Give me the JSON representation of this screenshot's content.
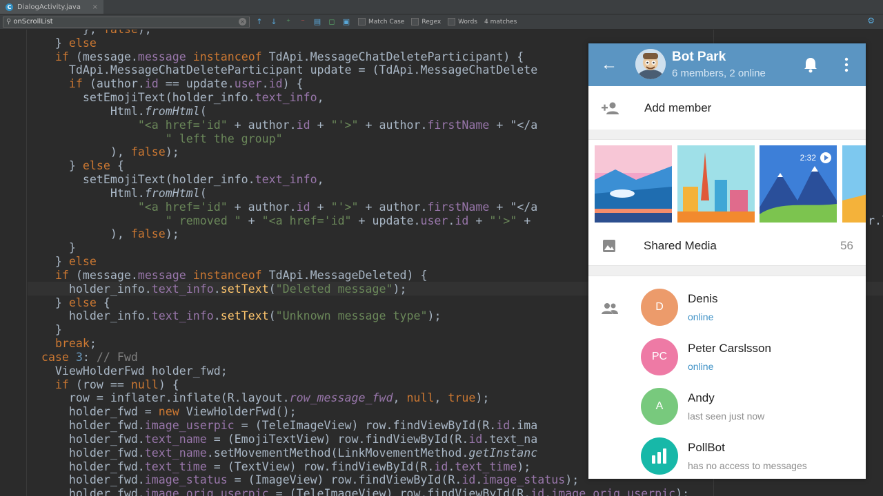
{
  "tab": {
    "title": "DialogActivity.java",
    "close": "×"
  },
  "find": {
    "query": "onScrollList",
    "options": [
      "Match Case",
      "Regex",
      "Words"
    ],
    "matches": "4 matches"
  },
  "code_lines": [
    "            }, false);",
    "        } else",
    "        if (message.message instanceof TdApi.MessageChatDeleteParticipant) {",
    "          TdApi.MessageChatDeleteParticipant update = (TdApi.MessageChatDelete",
    "          if (author.id == update.user.id) {",
    "            setEmojiText(holder_info.text_info,",
    "                Html.fromHtml(",
    "                    \"<a href='id\" + author.id + \"'>\" + author.firstName + \"</a",
    "                        \" left the group\"",
    "                ), false);",
    "          } else {",
    "            setEmojiText(holder_info.text_info,",
    "                Html.fromHtml(",
    "                    \"<a href='id\" + author.id + \"'>\" + author.firstName + \"</a",
    "                        \" removed \" + \"<a href='id\" + update.user.id + \"'>\" +",
    "                ), false);",
    "          }",
    "        } else",
    "        if (message.message instanceof TdApi.MessageDeleted) {",
    "          holder_info.text_info.setText(\"Deleted message\");",
    "        } else {",
    "          holder_info.text_info.setText(\"Unknown message type\");",
    "        }",
    "        break;",
    "      case 3: // Fwd",
    "        ViewHolderFwd holder_fwd;",
    "        if (row == null) {",
    "          row = inflater.inflate(R.layout.row_message_fwd, null, true);",
    "          holder_fwd = new ViewHolderFwd();",
    "          holder_fwd.image_userpic = (TeleImageView) row.findViewById(R.id.ima",
    "          holder_fwd.text_name = (EmojiTextView) row.findViewById(R.id.text_na",
    "          holder_fwd.text_name.setMovementMethod(LinkMovementMethod.getInstanc",
    "          holder_fwd.text_time = (TextView) row.findViewById(R.id.text_time);",
    "          holder_fwd.image_status = (ImageView) row.findViewById(R.id.image_status);",
    "          holder_fwd.image_orig_userpic = (TeleImageView) row.findViewById(R.id.image_orig_userpic);"
  ],
  "code_tail": "r.l",
  "chat": {
    "title": "Bot Park",
    "subtitle": "6 members, 2 online",
    "add_member": "Add member",
    "shared_media": {
      "label": "Shared Media",
      "count": "56"
    },
    "video_duration": "2:32",
    "members": [
      {
        "initials": "D",
        "name": "Denis",
        "status": "online",
        "online": true,
        "color": "#ec9b6b"
      },
      {
        "initials": "PC",
        "name": "Peter Carslsson",
        "status": "online",
        "online": true,
        "color": "#ee7aa5"
      },
      {
        "initials": "A",
        "name": "Andy",
        "status": "last seen just now",
        "online": false,
        "color": "#78c97d"
      },
      {
        "initials": "",
        "name": "PollBot",
        "status": "has no access to messages",
        "online": false,
        "color": "#17b8a8",
        "icon": "poll-icon"
      }
    ]
  },
  "colors": {
    "header": "#5b95c2",
    "online": "#3e91c6",
    "editor_bg": "#2b2b2b"
  }
}
